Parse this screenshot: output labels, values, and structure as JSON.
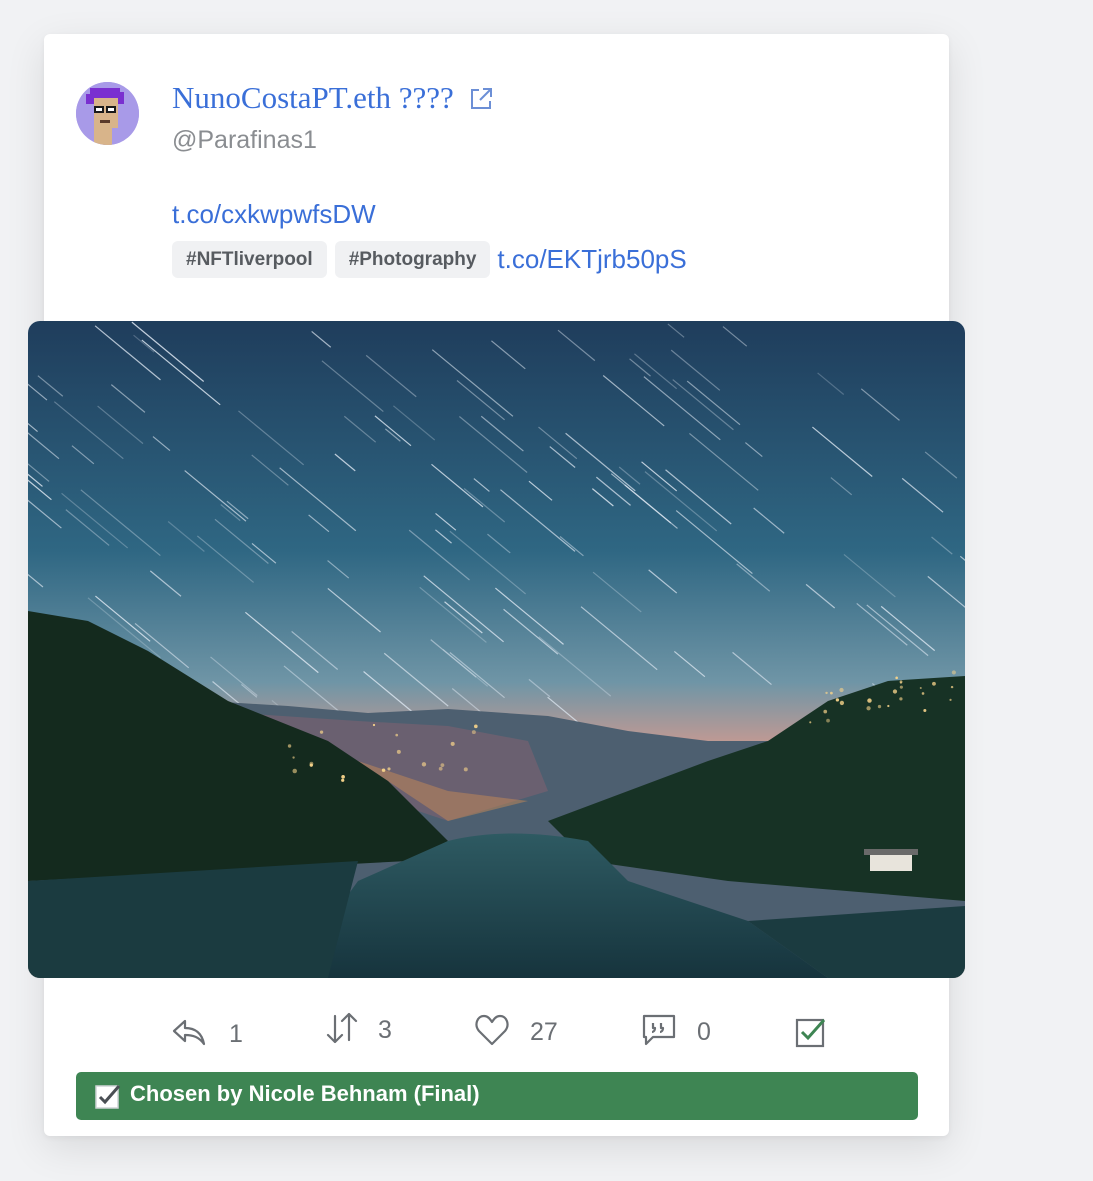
{
  "tweet": {
    "author_name": "NunoCostaPT.eth ????",
    "author_handle": "@Parafinas1",
    "link_primary": "t.co/cxkwpwfsDW",
    "hashtags": [
      "#NFTliverpool",
      "#Photography"
    ],
    "link_secondary": "t.co/EKTjrb50pS",
    "media_alt": "Star trails over a river valley at night"
  },
  "actions": {
    "reply_count": "1",
    "retweet_count": "3",
    "like_count": "27",
    "quote_count": "0"
  },
  "chosen_banner": {
    "label": "Chosen by Nicole Behnam (Final)"
  },
  "colors": {
    "link": "#3a6fd8",
    "banner": "#3e8553",
    "muted": "#8a8d91"
  },
  "icons": [
    "external-link-icon",
    "reply-icon",
    "retweet-icon",
    "heart-icon",
    "quote-icon",
    "checkbox-icon",
    "check-icon"
  ]
}
